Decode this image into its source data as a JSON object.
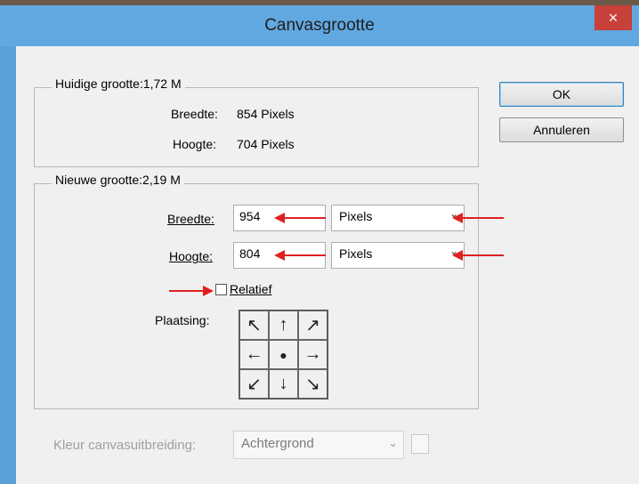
{
  "dialog": {
    "title": "Canvasgrootte",
    "close": "×"
  },
  "buttons": {
    "ok": "OK",
    "cancel": "Annuleren"
  },
  "current": {
    "legend": "Huidige grootte:1,72 M",
    "width_label": "Breedte:",
    "width_value": "854 Pixels",
    "height_label": "Hoogte:",
    "height_value": "704 Pixels"
  },
  "new": {
    "legend": "Nieuwe grootte:2,19 M",
    "width_label": "Breedte:",
    "width_value": "954",
    "width_unit": "Pixels",
    "height_label": "Hoogte:",
    "height_value": "804",
    "height_unit": "Pixels",
    "relative_label": "Relatief",
    "relative_checked": false,
    "anchor_label": "Plaatsing:",
    "anchor_cells": [
      "↖",
      "↑",
      "↗",
      "←",
      "●",
      "→",
      "↙",
      "↓",
      "↘"
    ]
  },
  "extension": {
    "label": "Kleur canvasuitbreiding:",
    "value": "Achtergrond"
  },
  "colors": {
    "arrow": "#e02020",
    "titlebar": "#62a8e0",
    "close": "#c7403a"
  }
}
